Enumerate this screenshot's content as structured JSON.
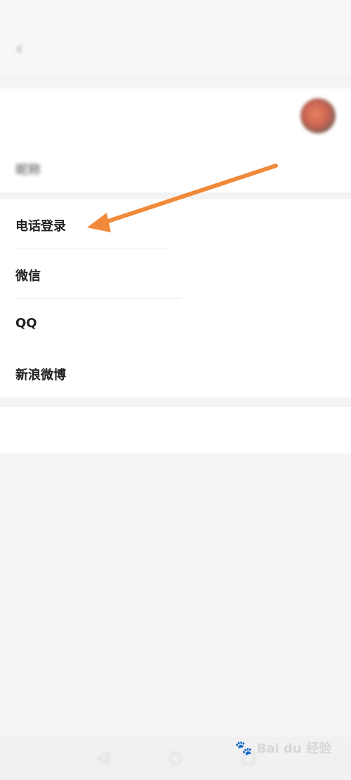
{
  "status_bar": {
    "left_text": "",
    "right_text": ""
  },
  "navbar": {
    "back_glyph": "‹",
    "title": ""
  },
  "profile": {
    "avatar_label": "",
    "nickname_label": "昵称",
    "nickname_value": ""
  },
  "accounts": [
    {
      "label": "电话登录",
      "value": "",
      "status": "blue"
    },
    {
      "label": "微信",
      "value": "",
      "status": "gray"
    },
    {
      "label": "QQ",
      "value": "",
      "status": "blue"
    },
    {
      "label": "新浪微博",
      "value": "",
      "status": "blue"
    }
  ],
  "logout_label": "",
  "bottom_nav": {
    "icons": [
      "back-icon",
      "home-icon",
      "recent-apps-icon"
    ]
  },
  "watermark": {
    "text": "Bai du 经验"
  },
  "annotation": {
    "arrow_color": "#f08a3a"
  }
}
